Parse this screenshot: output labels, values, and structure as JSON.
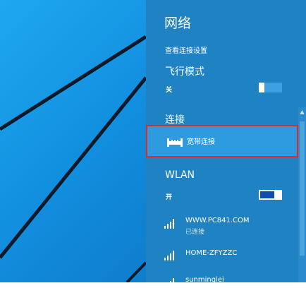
{
  "panel": {
    "title": "网络",
    "settings_link": "查看连接设置",
    "airplane": {
      "title": "飞行模式",
      "state_label": "关",
      "on": false
    },
    "connections": {
      "title": "连接",
      "items": [
        {
          "label": "宽带连接",
          "selected": true
        }
      ]
    },
    "wlan": {
      "title": "WLAN",
      "state_label": "开",
      "on": true,
      "networks": [
        {
          "name": "WWW.PC841.COM",
          "status": "已连接"
        },
        {
          "name": "HOME-ZFYZZC",
          "status": ""
        },
        {
          "name": "sunminglei",
          "status": ""
        }
      ]
    }
  },
  "colors": {
    "panel_bg": "#1f82c3",
    "highlight_border": "#e02a2a",
    "toggle_on": "#0c4fb0"
  },
  "icons": {
    "connection": "ethernet-icon",
    "network": "wifi-signal-icon"
  }
}
